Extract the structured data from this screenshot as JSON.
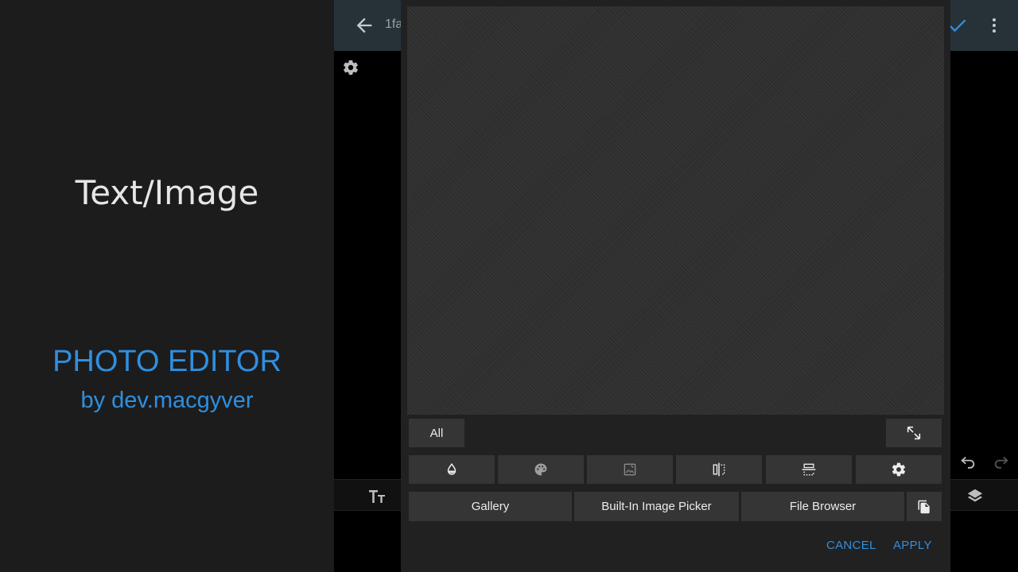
{
  "promo": {
    "title": "Text/Image",
    "app_name": "PHOTO EDITOR",
    "byline": "by dev.macgyver"
  },
  "app": {
    "filename": "1fa",
    "icons": [
      "back-arrow-icon",
      "check-icon",
      "more-vert-icon",
      "gear-icon",
      "undo-icon",
      "redo-icon",
      "text-tool-icon",
      "layers-icon"
    ],
    "accent_color": "#2f8fe0"
  },
  "dialog": {
    "category_label": "All",
    "tools": [
      "opacity-icon",
      "palette-icon",
      "image-edit-icon",
      "flip-horizontal-icon",
      "flip-vertical-icon",
      "settings-icon"
    ],
    "sources": {
      "gallery": "Gallery",
      "builtin": "Built-In Image Picker",
      "file_browser": "File Browser"
    },
    "cancel": "CANCEL",
    "apply": "APPLY"
  }
}
